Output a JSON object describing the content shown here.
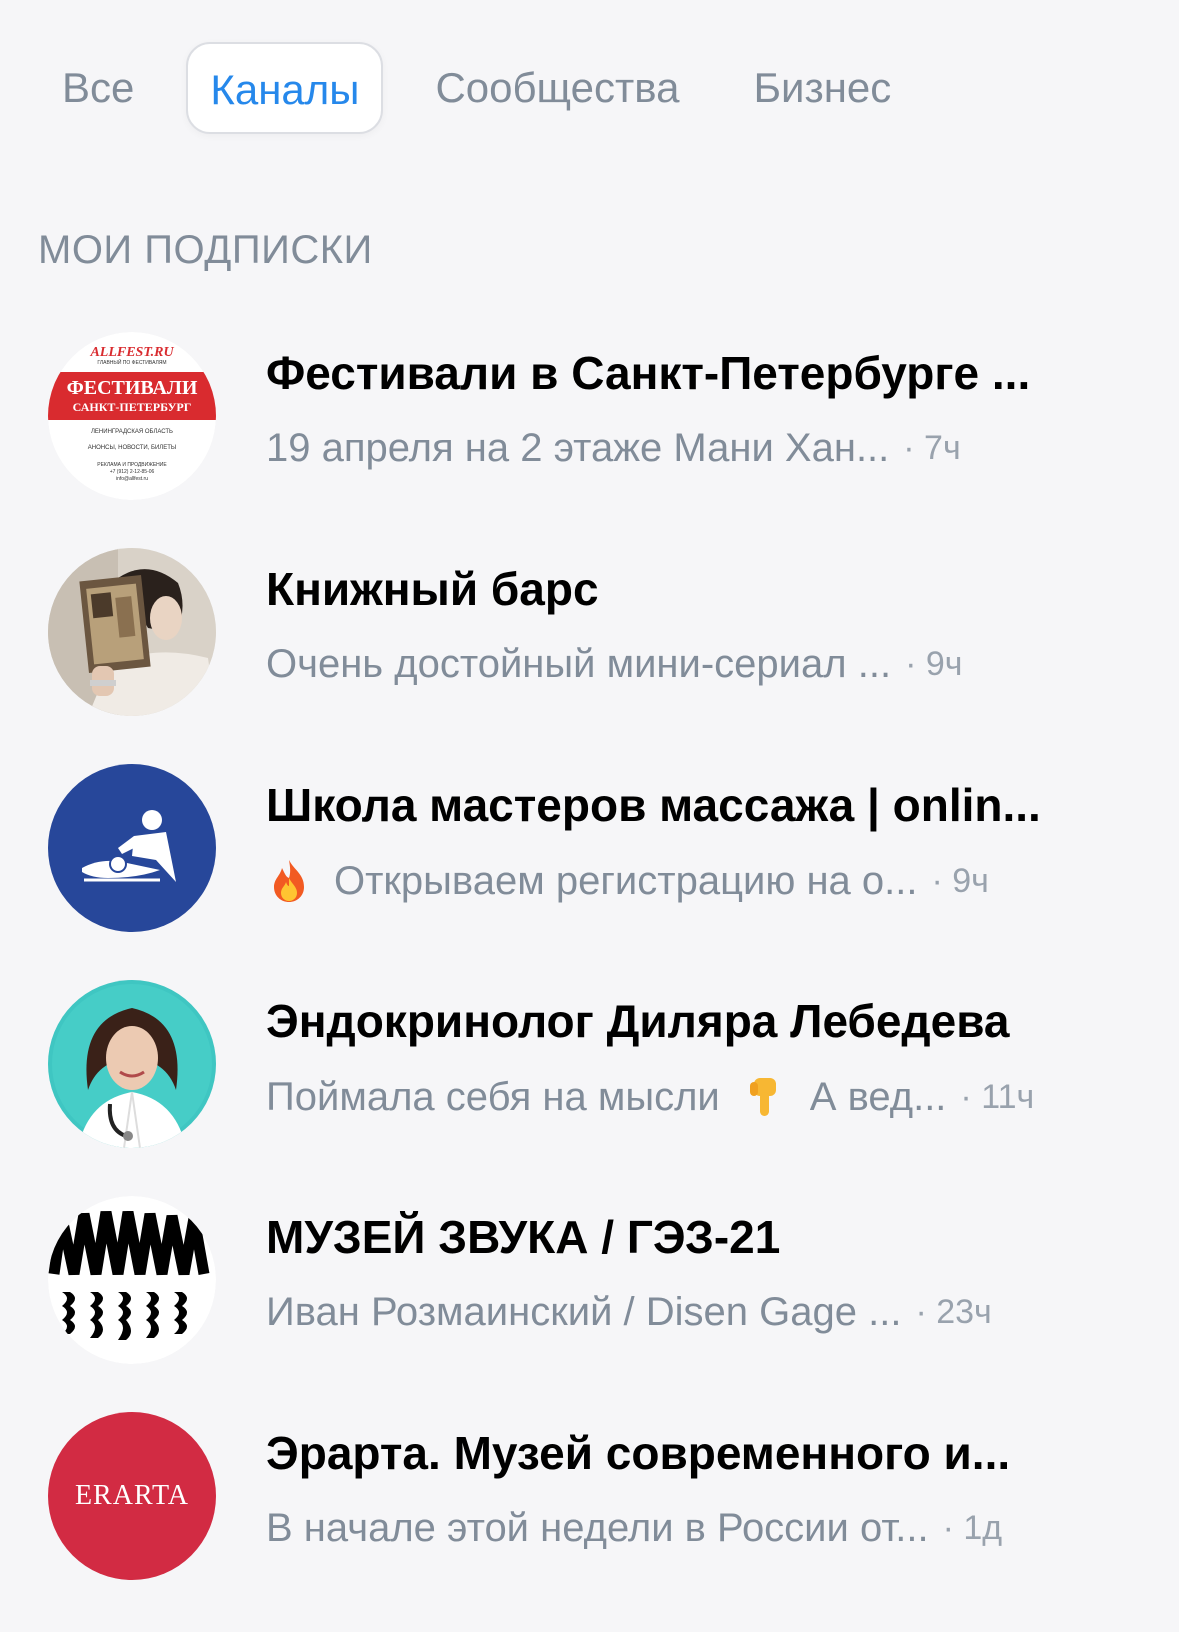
{
  "tabs": [
    {
      "label": "Все",
      "active": false
    },
    {
      "label": "Каналы",
      "active": true
    },
    {
      "label": "Сообщества",
      "active": false
    },
    {
      "label": "Бизнес",
      "active": false
    }
  ],
  "section_title": "МОИ ПОДПИСКИ",
  "colors": {
    "accent": "#2688eb",
    "secondary_text": "#818c99",
    "background": "#f6f6f8"
  },
  "chats": [
    {
      "name": "Фестивали в Санкт-Петербурге ...",
      "preview": "19 апреля на 2 этаже Мани Хан...",
      "time": "· 7ч",
      "avatar": {
        "icon": "allfest-logo",
        "brand": "ALLFEST.RU",
        "brand_sub": "ГЛАВНЫЙ ПО ФЕСТИВАЛЯМ",
        "title": "ФЕСТИВАЛИ",
        "subtitle": "САНКТ-ПЕТЕРБУРГ",
        "region": "ЛЕНИНГРАДСКАЯ ОБЛАСТЬ",
        "tagline": "АНОНСЫ, НОВОСТИ, БИЛЕТЫ",
        "ad": "РЕКЛАМА И ПРОДВИЖЕНИЕ",
        "phone": "+7 (912) 2-12-85-06",
        "email": "info@allfest.ru",
        "color": "#d92b2f"
      }
    },
    {
      "name": "Книжный барс",
      "preview": "Очень достойный мини-сериал ...",
      "time": "· 9ч",
      "avatar": {
        "icon": "person-with-book-photo"
      }
    },
    {
      "name": "Школа мастеров массажа | onlin...",
      "preview": "Открываем регистрацию на о...",
      "preview_emoji": "fire-emoji",
      "time": "· 9ч",
      "avatar": {
        "icon": "massage-logo",
        "color": "#27479a"
      }
    },
    {
      "name": "Эндокринолог Диляра Лебедева",
      "preview_before": "Поймала себя на мысли",
      "preview_emoji": "pointing-down-emoji",
      "preview": "А вед...",
      "time": "· 11ч",
      "avatar": {
        "icon": "doctor-portrait-photo",
        "color": "#3fc6c2"
      }
    },
    {
      "name": "МУЗЕЙ ЗВУКА / ГЭЗ-21",
      "preview": "Иван Розмаинский / Disen Gage ...",
      "time": "· 23ч",
      "avatar": {
        "icon": "sound-wave-logo"
      }
    },
    {
      "name": "Эрарта. Музей современного и...",
      "preview": "В начале этой недели в России от...",
      "time": "· 1д",
      "avatar": {
        "icon": "erarta-logo",
        "text": "ERARTA",
        "color": "#d22b43"
      }
    }
  ]
}
